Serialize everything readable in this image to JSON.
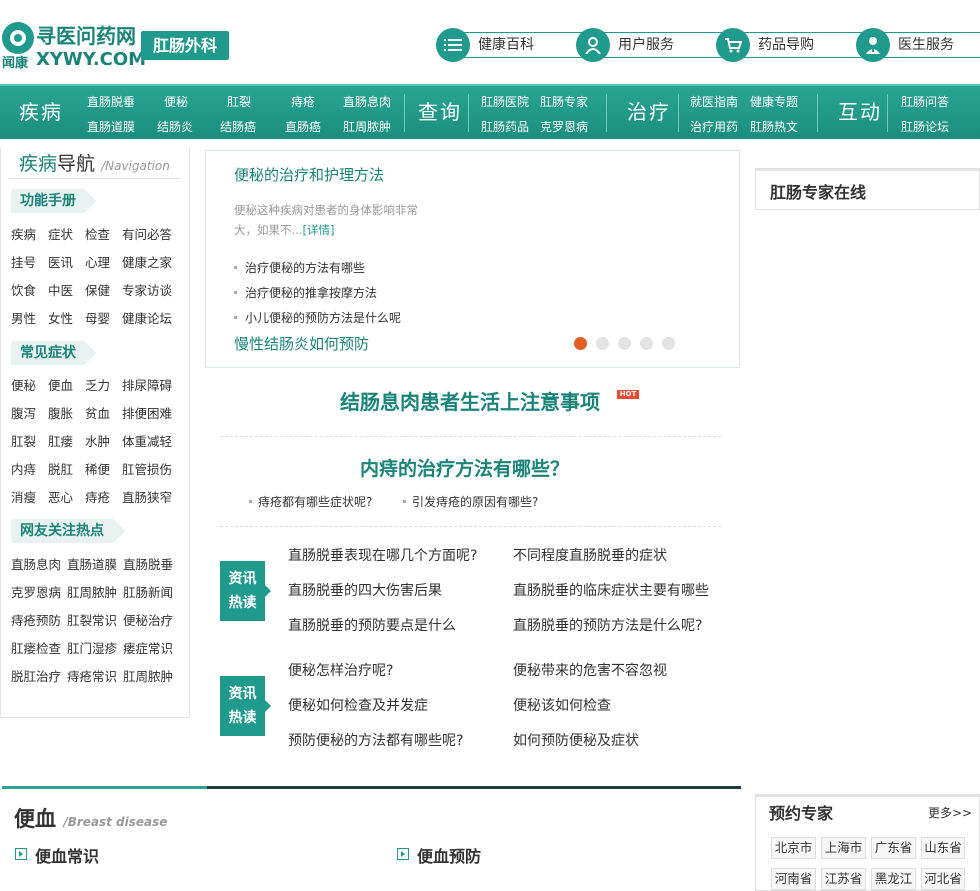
{
  "logo": {
    "cn": "寻医问药网",
    "sub": "闻康",
    "en": "XYWY.COM"
  },
  "section_badge": "肛肠外科",
  "header_nav": [
    {
      "label": "健康百科",
      "icon": "list-icon"
    },
    {
      "label": "用户服务",
      "icon": "user-icon"
    },
    {
      "label": "药品导购",
      "icon": "cart-icon"
    },
    {
      "label": "医生服务",
      "icon": "doctor-icon"
    }
  ],
  "main_nav": {
    "disease": {
      "title": "疾病",
      "links": [
        "直肠脱垂",
        "便秘",
        "肛裂",
        "痔疮",
        "直肠息肉",
        "直肠道膜",
        "结肠炎",
        "结肠癌",
        "直肠癌",
        "肛周脓肿"
      ]
    },
    "query": {
      "title": "查询",
      "links": [
        "肛肠医院",
        "肛肠专家",
        "肛肠药品",
        "克罗恩病"
      ]
    },
    "treat": {
      "title": "治疗",
      "links": [
        "就医指南",
        "健康专题",
        "治疗用药",
        "肛肠热文"
      ]
    },
    "interact": {
      "title": "互动",
      "links": [
        "肛肠问答",
        "肛肠论坛"
      ]
    }
  },
  "sidebar": {
    "title_a": "疾病",
    "title_b": "导航",
    "title_en": "/Navigation",
    "handbook": {
      "tag": "功能手册",
      "links": [
        "疾病",
        "症状",
        "检查",
        "有问必答",
        "挂号",
        "医讯",
        "心理",
        "健康之家",
        "饮食",
        "中医",
        "保健",
        "专家访谈",
        "男性",
        "女性",
        "母婴",
        "健康论坛"
      ]
    },
    "symptoms": {
      "tag": "常见症状",
      "links": [
        "便秘",
        "便血",
        "乏力",
        "排尿障碍",
        "腹泻",
        "腹胀",
        "贫血",
        "排便困难",
        "肛裂",
        "肛瘘",
        "水肿",
        "体重减轻",
        "内痔",
        "脱肛",
        "稀便",
        "肛管损伤",
        "消瘦",
        "恶心",
        "痔疮",
        "直肠狭窄"
      ]
    },
    "hot": {
      "tag": "网友关注热点",
      "links": [
        "直肠息肉",
        "直肠道膜",
        "直肠脱垂",
        "克罗恩病",
        "肛周脓肿",
        "肛肠新闻",
        "痔疮预防",
        "肛裂常识",
        "便秘治疗",
        "肛瘘检查",
        "肛门湿疹",
        "瘘症常识",
        "脱肛治疗",
        "痔疮常识",
        "肛周脓肿"
      ]
    }
  },
  "carousel": {
    "title": "便秘的治疗和护理方法",
    "desc": "便秘这种疾病对患者的身体影响非常大，如果不...",
    "more": "[详情]",
    "items": [
      "治疗便秘的方法有哪些",
      "治疗便秘的推拿按摩方法",
      "小儿便秘的预防方法是什么呢"
    ],
    "bottom_title": "慢性结肠炎如何预防",
    "dots_total": 5,
    "dot_active": 1
  },
  "headline1": "结肠息肉患者生活上注意事项",
  "hot_label": "HOT",
  "headline2": "内痔的治疗方法有哪些？",
  "sub_links": [
    "痔疮都有哪些症状呢?",
    "引发痔疮的原因有哪些?"
  ],
  "news_badge": {
    "line1": "资讯",
    "line2": "热读"
  },
  "news_group1": [
    "直肠脱垂表现在哪几个方面呢?",
    "不同程度直肠脱垂的症状",
    "直肠脱垂的四大伤害后果",
    "直肠脱垂的临床症状主要有哪些",
    "直肠脱垂的预防要点是什么",
    "直肠脱垂的预防方法是什么呢?"
  ],
  "news_group2": [
    "便秘怎样治疗呢?",
    "便秘带来的危害不容忽视",
    "便秘如何检查及并发症",
    "便秘该如何检查",
    "预防便秘的方法都有哪些呢?",
    "如何预防便秘及症状"
  ],
  "right_box_title": "肛肠专家在线",
  "bianxue": {
    "title": "便血",
    "en": "/Breast disease"
  },
  "sections": [
    "便血常识",
    "便血预防"
  ],
  "expert": {
    "title": "预约专家",
    "more": "更多>>",
    "provinces": [
      "北京市",
      "上海市",
      "广东省",
      "山东省",
      "河南省",
      "江苏省",
      "黑龙江",
      "河北省"
    ]
  },
  "colors": {
    "brand": "#1f9a8c",
    "accent": "#e15f25",
    "dark": "#243a40"
  }
}
